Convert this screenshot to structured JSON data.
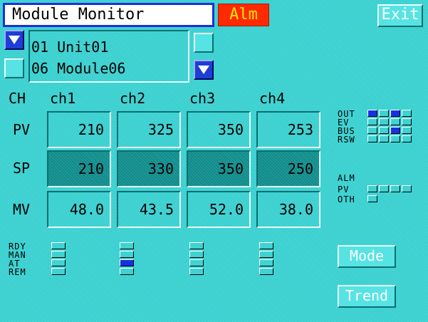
{
  "window_title": "Module Monitor",
  "alarm_label": "Alm",
  "exit_label": "Exit",
  "module_list": [
    {
      "num": "01",
      "name": "Unit01"
    },
    {
      "num": "06",
      "name": "Module06"
    }
  ],
  "table": {
    "ch_header": "CH",
    "channels": [
      "ch1",
      "ch2",
      "ch3",
      "ch4"
    ],
    "rows": [
      {
        "label": "PV",
        "values": [
          "210",
          "325",
          "350",
          "253"
        ]
      },
      {
        "label": "SP",
        "values": [
          "210",
          "330",
          "350",
          "250"
        ]
      },
      {
        "label": "MV",
        "values": [
          "48.0",
          "43.5",
          "52.0",
          "38.0"
        ]
      }
    ]
  },
  "status_rows": [
    "RDY",
    "MAN",
    "AT",
    "REM"
  ],
  "channel_status": [
    [
      false,
      false,
      false,
      false
    ],
    [
      false,
      false,
      true,
      false
    ],
    [
      false,
      false,
      false,
      false
    ],
    [
      false,
      false,
      false,
      false
    ]
  ],
  "io_panel": {
    "out_label": "OUT",
    "out": [
      true,
      false,
      true,
      false
    ],
    "ev_label": "EV",
    "ev": [
      false,
      false,
      false,
      false
    ],
    "bus_label": "BUS",
    "bus": [
      false,
      false,
      true,
      false
    ],
    "rsw_label": "RSW",
    "rsw": [
      false,
      false,
      false,
      false
    ]
  },
  "alarm_panel": {
    "alm_label": "ALM",
    "pv_label": "PV",
    "pv": [
      false,
      false,
      false,
      false
    ],
    "oth_label": "OTH",
    "oth": [
      false
    ]
  },
  "mode_label": "Mode",
  "trend_label": "Trend",
  "colors": {
    "background": "#3ad0d0",
    "alarm": "#ff2a00",
    "indicator_on": "#1a2fe0"
  }
}
